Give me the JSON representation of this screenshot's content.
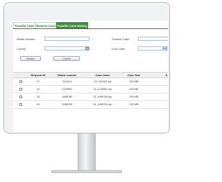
{
  "tabs": [
    {
      "label": "Transfer Case",
      "active": false
    },
    {
      "label": "Reserve Case",
      "active": false
    },
    {
      "label": "Transfer Case History",
      "active": true
    }
  ],
  "form": {
    "waste_number_label": "Waste Number",
    "county_label": "County",
    "transfer_case_label": "Transfer Case",
    "from_date_label": "From Date",
    "dropdown_icon": "chevron-down-icon",
    "calendar_icon": "calendar-icon",
    "search_label": "Search",
    "cancel_label": "Cancel"
  },
  "table": {
    "headers": [
      "Request ID",
      "Waste number",
      "Case name",
      "Case Size",
      "S"
    ],
    "rows": [
      [
        "21",
        "1111111",
        "22_1111111.zip",
        "300 MB"
      ],
      [
        "22",
        "1234567",
        "11_1234567.zip",
        "400 MB"
      ],
      [
        "23",
        "3456789",
        "11_3456789.zip",
        "200 MB"
      ],
      [
        "24",
        "3456789",
        "31_3456781.zip",
        "200 MB"
      ]
    ]
  },
  "colors": {
    "accent": "#3f8a3f",
    "input_border": "#a8c0e0"
  }
}
